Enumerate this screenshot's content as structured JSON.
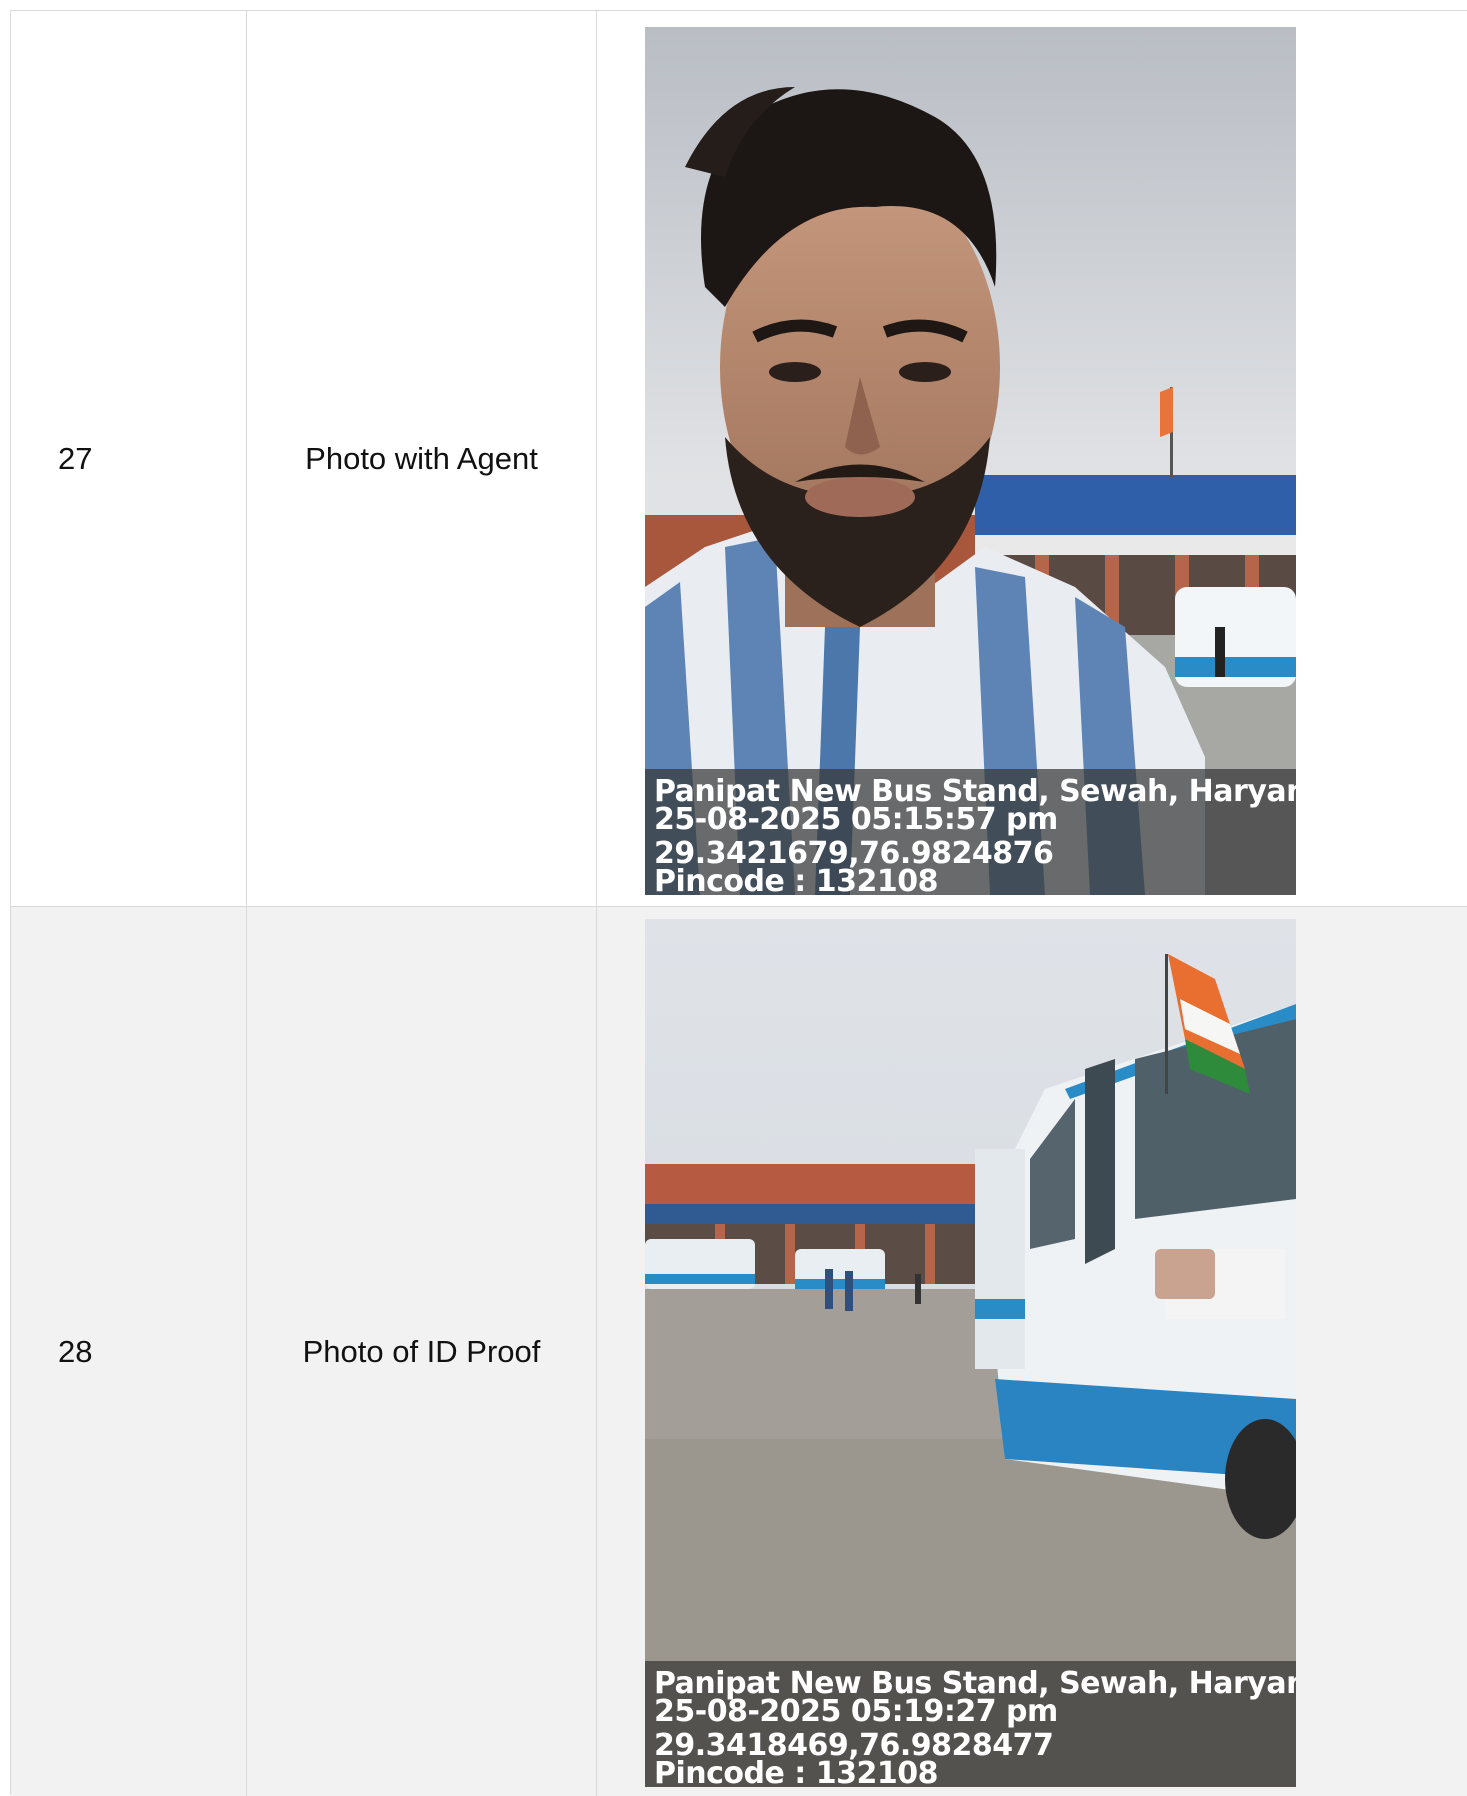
{
  "rows": [
    {
      "number": "27",
      "label": "Photo with Agent",
      "photo": {
        "description_icon": "selfie-photo",
        "caption": {
          "location": "Panipat New Bus Stand, Sewah, Haryana ...",
          "datetime": "25-08-2025 05:15:57 pm",
          "coordinates": "29.3421679,76.9824876",
          "pincode": "Pincode : 132108"
        }
      }
    },
    {
      "number": "28",
      "label": "Photo of ID Proof",
      "photo": {
        "description_icon": "bus-stand-photo",
        "caption": {
          "location": "Panipat New Bus Stand, Sewah, Haryana ...",
          "datetime": "25-08-2025 05:19:27 pm",
          "coordinates": "29.3418469,76.9828477",
          "pincode": "Pincode : 132108"
        }
      }
    }
  ],
  "colors": {
    "border": "#d9d9d9",
    "row_alt_bg": "#f2f2f2",
    "caption_bg": "#373737"
  }
}
